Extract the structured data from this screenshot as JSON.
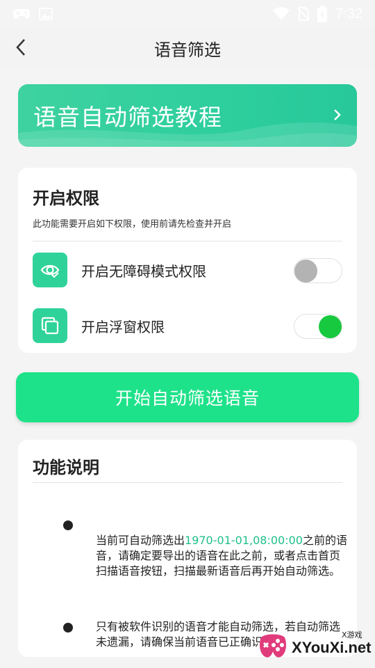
{
  "status_bar": {
    "time": "7:32",
    "left_icons": [
      "gamepad-icon",
      "image-icon"
    ],
    "right_icons": [
      "wifi-icon",
      "no-sim-icon",
      "battery-charging-icon"
    ]
  },
  "app_bar": {
    "title": "语音筛选",
    "back_icon": "chevron-left-icon"
  },
  "tutorial_banner": {
    "title": "语音自动筛选教程",
    "arrow_icon": "chevron-right-icon"
  },
  "permissions": {
    "title": "开启权限",
    "description": "此功能需要开启如下权限，使用前请先检查并开启",
    "items": [
      {
        "label": "开启无障碍模式权限",
        "icon": "accessibility-eye-icon",
        "enabled": false
      },
      {
        "label": "开启浮窗权限",
        "icon": "floating-window-icon",
        "enabled": true
      }
    ]
  },
  "start_button": {
    "label": "开始自动筛选语音"
  },
  "info": {
    "title": "功能说明",
    "bullet1": {
      "before": "当前可自动筛选出",
      "highlight": "1970-01-01,08:00:00",
      "after": "之前的语音，请确定要导出的语音在此之前，或者点击首页扫描语音按钮，扫描最新语音后再开始自动筛选。"
    },
    "bullet2": {
      "text": "只有被软件识别的语音才能自动筛选，若自动筛选未遗漏，请确保当前语音已正确识别"
    }
  },
  "watermark": {
    "text": "XYouXi.net",
    "sub": "X游戏"
  },
  "colors": {
    "accent_green": "#2fd39a",
    "button_green": "#1ee28a",
    "toggle_on": "#17c93f",
    "toggle_off": "#b3b3b3",
    "highlight": "#1fc08a"
  }
}
